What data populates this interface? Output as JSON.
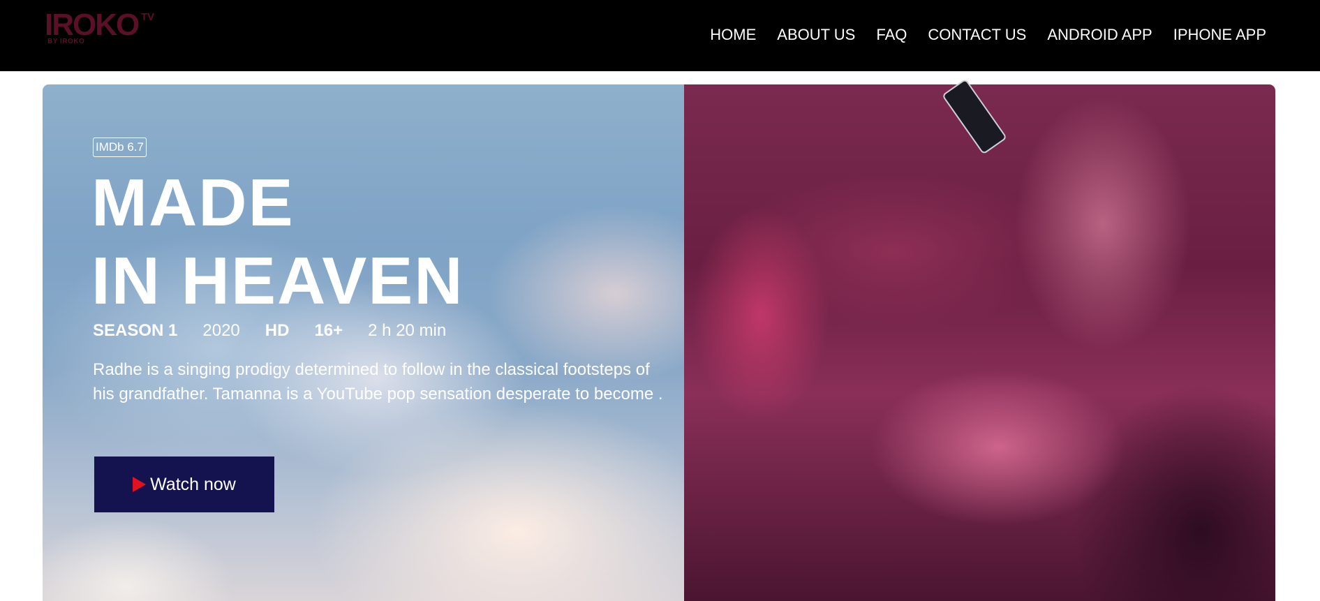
{
  "header": {
    "logo_text": "IROKO",
    "logo_sup": "TV",
    "logo_sub": "BY IROKO",
    "nav": [
      "HOME",
      "ABOUT US",
      "FAQ",
      "CONTACT US",
      "ANDROID APP",
      "IPHONE APP"
    ]
  },
  "hero": {
    "imdb": "IMDb 6.7",
    "title_line1": "MADE",
    "title_line2": "IN HEAVEN",
    "season": "SEASON 1",
    "year": "2020",
    "quality": "HD",
    "rating": "16+",
    "duration": "2 h 20 min",
    "description": "Radhe is a singing prodigy determined to follow in the classical footsteps of his grandfather. Tamanna is a YouTube pop sensation desperate to become .",
    "watch_label": "Watch now"
  },
  "colors": {
    "header_bg": "#000000",
    "button_bg": "#15134f",
    "play_icon": "#e0121f",
    "logo": "#5a1028"
  }
}
